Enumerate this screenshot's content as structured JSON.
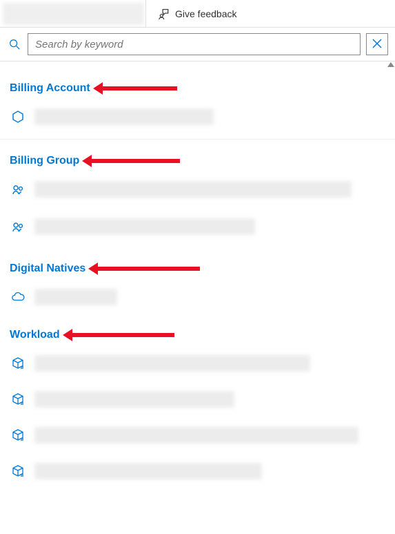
{
  "header": {
    "feedback_label": "Give feedback"
  },
  "search": {
    "placeholder": "Search by keyword",
    "value": ""
  },
  "sections": {
    "billing_account": {
      "title": "Billing Account"
    },
    "billing_group": {
      "title": "Billing Group"
    },
    "digital_natives": {
      "title": "Digital Natives"
    },
    "workload": {
      "title": "Workload"
    }
  },
  "colors": {
    "accent": "#0078d4",
    "annotation_arrow": "#e81123"
  }
}
